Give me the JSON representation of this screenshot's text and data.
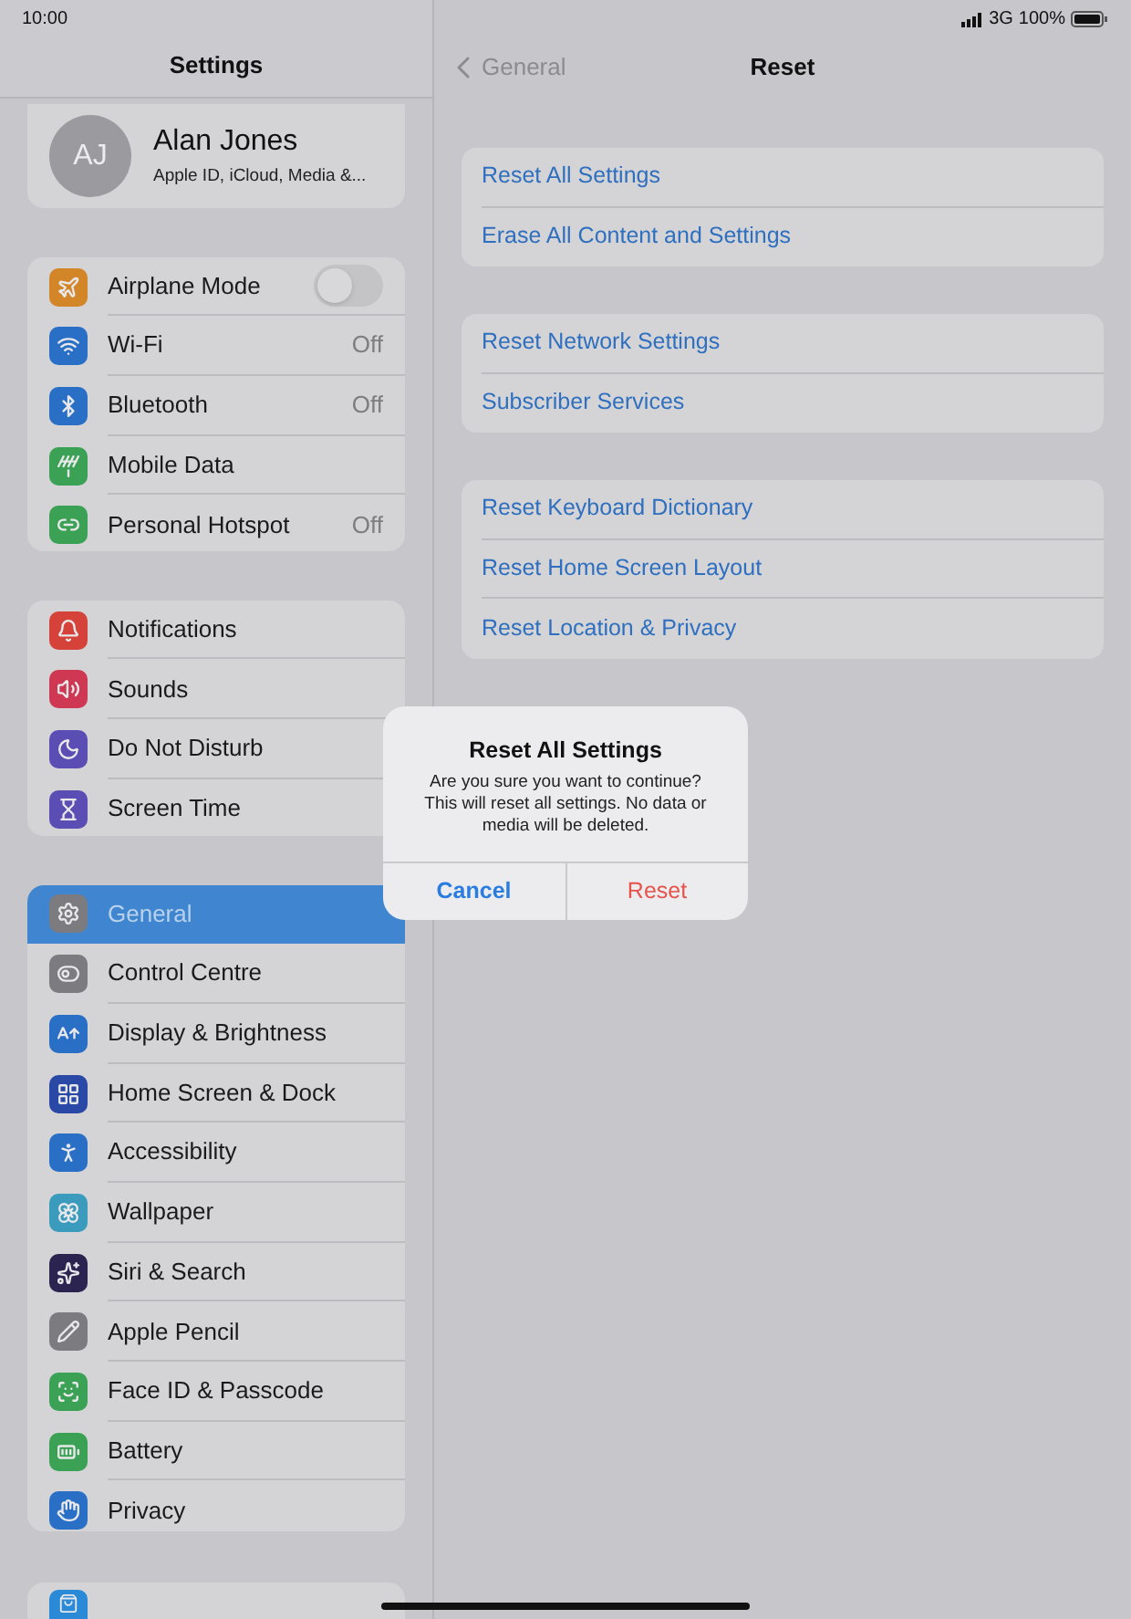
{
  "status_bar": {
    "time": "10:00",
    "network": "3G",
    "battery": "100%"
  },
  "sidebar": {
    "title": "Settings",
    "profile": {
      "initials": "AJ",
      "name": "Alan Jones",
      "subtitle": "Apple ID, iCloud, Media &..."
    },
    "groups": [
      {
        "items": [
          {
            "label": "Airplane Mode",
            "kind": "toggle",
            "on": false,
            "selected": false,
            "color": "#d38628"
          },
          {
            "label": "Wi-Fi",
            "kind": "value",
            "value": "Off",
            "selected": false,
            "color": "#2a6fc6"
          },
          {
            "label": "Bluetooth",
            "kind": "value",
            "value": "Off",
            "selected": false,
            "color": "#2a6fc6"
          },
          {
            "label": "Mobile Data",
            "kind": "plain",
            "selected": false,
            "color": "#3aa155"
          },
          {
            "label": "Personal Hotspot",
            "kind": "value",
            "value": "Off",
            "selected": false,
            "color": "#3aa155"
          }
        ]
      },
      {
        "items": [
          {
            "label": "Notifications",
            "kind": "plain",
            "selected": false,
            "color": "#d4423a"
          },
          {
            "label": "Sounds",
            "kind": "plain",
            "selected": false,
            "color": "#cf3852"
          },
          {
            "label": "Do Not Disturb",
            "kind": "plain",
            "selected": false,
            "color": "#5a4db3"
          },
          {
            "label": "Screen Time",
            "kind": "plain",
            "selected": false,
            "color": "#5a4db3"
          }
        ]
      },
      {
        "items": [
          {
            "label": "General",
            "kind": "plain",
            "selected": true,
            "color": "#7b7b80"
          },
          {
            "label": "Control Centre",
            "kind": "plain",
            "selected": false,
            "color": "#7b7b80"
          },
          {
            "label": "Display & Brightness",
            "kind": "plain",
            "selected": false,
            "color": "#2a6fc6"
          },
          {
            "label": "Home Screen & Dock",
            "kind": "plain",
            "selected": false,
            "color": "#2a48a6"
          },
          {
            "label": "Accessibility",
            "kind": "plain",
            "selected": false,
            "color": "#2a6fc6"
          },
          {
            "label": "Wallpaper",
            "kind": "plain",
            "selected": false,
            "color": "#3a9bbd"
          },
          {
            "label": "Siri & Search",
            "kind": "plain",
            "selected": false,
            "color": "#2b2350"
          },
          {
            "label": "Apple Pencil",
            "kind": "plain",
            "selected": false,
            "color": "#7b7b80"
          },
          {
            "label": "Face ID & Passcode",
            "kind": "plain",
            "selected": false,
            "color": "#3aa155"
          },
          {
            "label": "Battery",
            "kind": "plain",
            "selected": false,
            "color": "#3aa155"
          },
          {
            "label": "Privacy",
            "kind": "plain",
            "selected": false,
            "color": "#2a6fc6"
          }
        ]
      }
    ]
  },
  "detail": {
    "back": "General",
    "title": "Reset",
    "groups": [
      {
        "items": [
          "Reset All Settings",
          "Erase All Content and Settings"
        ]
      },
      {
        "items": [
          "Reset Network Settings",
          "Subscriber Services"
        ]
      },
      {
        "items": [
          "Reset Keyboard Dictionary",
          "Reset Home Screen Layout",
          "Reset Location & Privacy"
        ]
      }
    ]
  },
  "alert": {
    "title": "Reset All Settings",
    "message": "Are you sure you want to continue? This will reset all settings. No data or media will be deleted.",
    "buttons": [
      {
        "label": "Cancel",
        "kind": "cancel"
      },
      {
        "label": "Reset",
        "kind": "destructive"
      }
    ]
  }
}
